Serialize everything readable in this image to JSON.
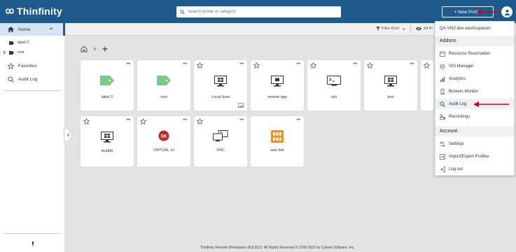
{
  "header": {
    "logo_text": "Thinfinity",
    "search_placeholder": "Search profile or category",
    "new_profile_label": "+ New Profile"
  },
  "sidebar": {
    "home_label": "Home",
    "sub_items": [
      {
        "label": "label 2"
      },
      {
        "label": "root"
      }
    ],
    "favorites_label": "Favorites",
    "audit_log_label": "Audit Log"
  },
  "toolbar": {
    "filter_label": "Filter Kind",
    "all_label": "All Pr"
  },
  "cards_row1": [
    {
      "label": "label 2",
      "icon": "tag-icon"
    },
    {
      "label": "root",
      "icon": "tag-icon"
    },
    {
      "label": "Local Host",
      "icon": "monitor-icon"
    },
    {
      "label": "remote app",
      "icon": "monitor-icon"
    },
    {
      "label": "ssh",
      "icon": "terminal-icon"
    },
    {
      "label": "test",
      "icon": "monitor-icon"
    }
  ],
  "cards_row2": [
    {
      "label": "testttttt",
      "icon": "monitor-icon"
    },
    {
      "label": "VIRTUAL UI",
      "icon": "virtualui-icon",
      "badge": "DK"
    },
    {
      "label": "VNC",
      "icon": "vnc-icon"
    },
    {
      "label": "web link",
      "icon": "weblink-icon"
    }
  ],
  "menu": {
    "user": "QA-VM2-dev-east\\supteam",
    "addons_title": "Addons",
    "addons": [
      {
        "label": "Resource Reservation"
      },
      {
        "label": "VDI Manager"
      },
      {
        "label": "Analytics"
      },
      {
        "label": "Brokers Monitor"
      },
      {
        "label": "Audit Log"
      },
      {
        "label": "Recordings"
      }
    ],
    "account_title": "Account",
    "account": [
      {
        "label": "Settings"
      },
      {
        "label": "Import/Export Profiles"
      },
      {
        "label": "Log out"
      }
    ]
  },
  "footer": "Thinfinity Remote Workspace v8.8.9113. All Rights Reserved © 2010-2023 by Cybele Software, Inc.",
  "colors": {
    "header": "#1f5a8c",
    "tag_green": "#7bc98a",
    "arrow_red": "#d0021b"
  }
}
